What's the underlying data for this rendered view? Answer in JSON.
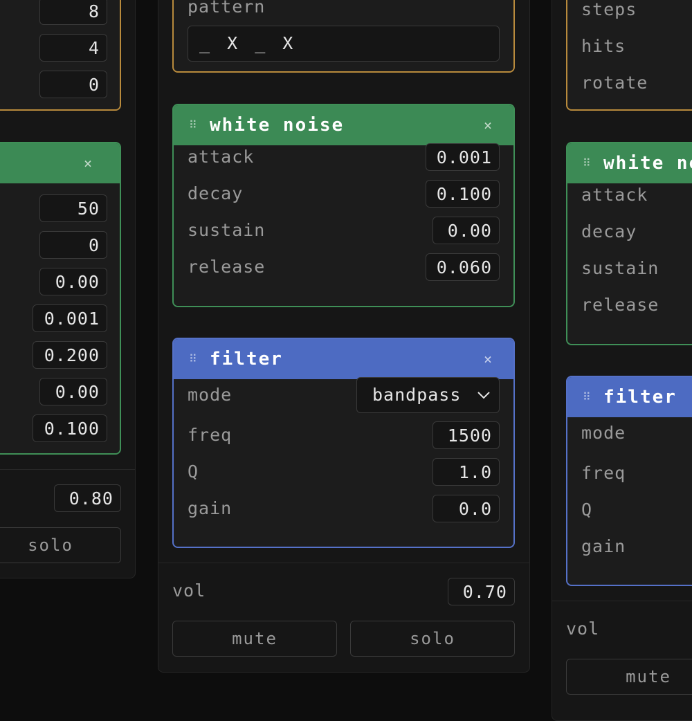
{
  "left_column": {
    "sequencer": {
      "values": [
        "8",
        "4",
        "0"
      ]
    },
    "noise": {
      "close_icon": "×",
      "values": [
        "50",
        "0",
        "0.00",
        "0.001",
        "0.200",
        "0.00",
        "0.100"
      ]
    },
    "vol_value": "0.80",
    "solo_label": "solo"
  },
  "center_column": {
    "sequencer": {
      "pattern_label": "pattern",
      "pattern_value": "_ X _ X"
    },
    "noise": {
      "grip_icon": "⠿",
      "title": "white noise",
      "close_icon": "×",
      "params": [
        {
          "label": "attack",
          "value": "0.001"
        },
        {
          "label": "decay",
          "value": "0.100"
        },
        {
          "label": "sustain",
          "value": "0.00"
        },
        {
          "label": "release",
          "value": "0.060"
        }
      ]
    },
    "filter": {
      "grip_icon": "⠿",
      "title": "filter",
      "close_icon": "×",
      "mode_label": "mode",
      "mode_value": "bandpass",
      "params": [
        {
          "label": "freq",
          "value": "1500"
        },
        {
          "label": "Q",
          "value": "1.0"
        },
        {
          "label": "gain",
          "value": "0.0"
        }
      ]
    },
    "vol_label": "vol",
    "vol_value": "0.70",
    "mute_label": "mute",
    "solo_label": "solo"
  },
  "right_column": {
    "sequencer": {
      "labels": [
        "steps",
        "hits",
        "rotate"
      ]
    },
    "noise": {
      "grip_icon": "⠿",
      "title": "white noise",
      "labels": [
        "attack",
        "decay",
        "sustain",
        "release"
      ]
    },
    "filter": {
      "grip_icon": "⠿",
      "title": "filter",
      "labels": [
        "mode",
        "freq",
        "Q",
        "gain"
      ]
    },
    "vol_label": "vol",
    "mute_label": "mute"
  },
  "colors": {
    "background": "#0d0d0d",
    "column": "#161616",
    "sequencer_border": "#b88a3c",
    "noise_header": "#3c8a55",
    "filter_header": "#4d6bc2"
  }
}
